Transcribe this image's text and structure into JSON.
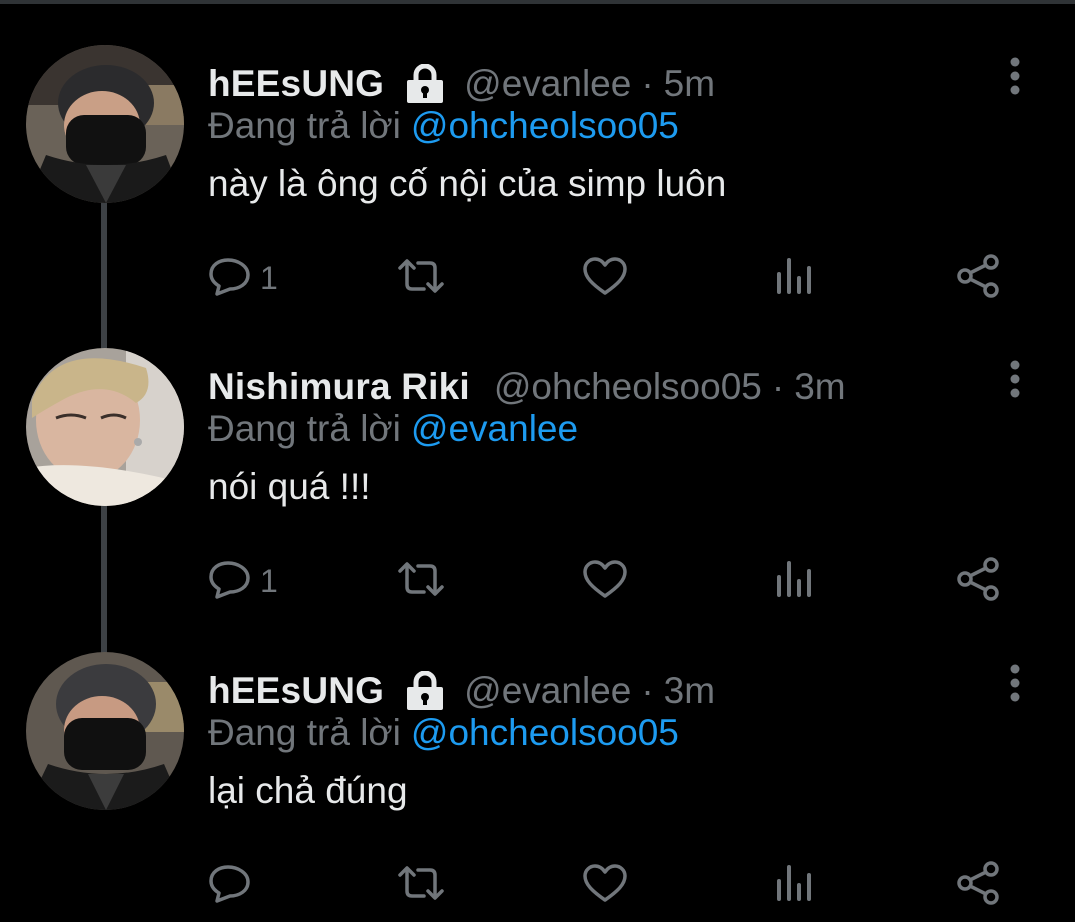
{
  "colors": {
    "background": "#000000",
    "primary_text": "#e7e9ea",
    "secondary_text": "#71767b",
    "accent": "#1d9bf0",
    "thread_line": "#3d4145"
  },
  "tweets": [
    {
      "avatar_icon": "avatar-masked-person",
      "name": "hEEsUNG",
      "locked": true,
      "handle": "@evanlee",
      "separator": "·",
      "time": "5m",
      "replying_label": "Đang trả lời",
      "replying_to": "@ohcheolsoo05",
      "text": "này là ông cố nội của simp luôn",
      "reply_count": "1"
    },
    {
      "avatar_icon": "avatar-blond-person",
      "name": "Nishimura Riki",
      "locked": false,
      "handle": "@ohcheolsoo05",
      "separator": "·",
      "time": "3m",
      "replying_label": "Đang trả lời",
      "replying_to": "@evanlee",
      "text": "nói quá !!!",
      "reply_count": "1"
    },
    {
      "avatar_icon": "avatar-masked-person",
      "name": "hEEsUNG",
      "locked": true,
      "handle": "@evanlee",
      "separator": "·",
      "time": "3m",
      "replying_label": "Đang trả lời",
      "replying_to": "@ohcheolsoo05",
      "text": "lại chả đúng",
      "reply_count": ""
    }
  ],
  "action_icons": [
    "reply-icon",
    "retweet-icon",
    "like-icon",
    "analytics-icon",
    "share-icon"
  ]
}
